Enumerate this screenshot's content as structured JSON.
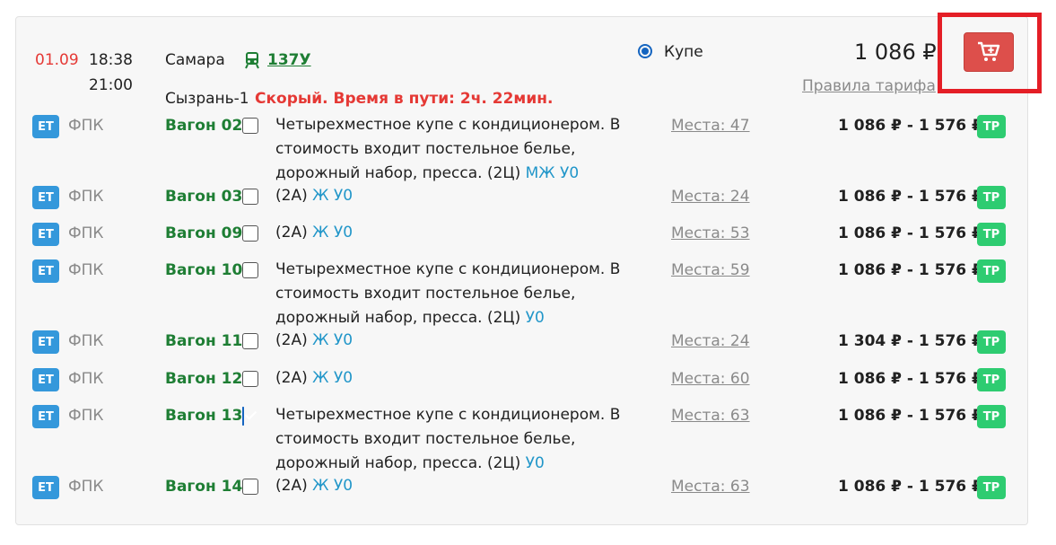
{
  "header": {
    "date": "01.09",
    "depart_time": "18:38",
    "arrive_time": "21:00",
    "from_station": "Самара",
    "train_number": "137У",
    "to_station": "Сызрань-1",
    "route_info": "Скорый. Время в пути: 2ч. 22мин.",
    "class_label": "Купе",
    "price": "1 086 ₽",
    "tariff_link": "Правила тарифа",
    "icons": {
      "train": "train-icon",
      "cart": "cart-plus-icon"
    }
  },
  "colors": {
    "accent_red": "#dd4f4b",
    "highlight": "#e41e26",
    "green_link": "#1e7e34",
    "tag_blue": "#2196c9",
    "badge_blue": "#3498db",
    "badge_green": "#2ecc71"
  },
  "wagons": [
    {
      "badge": "ЕТ",
      "carrier": "ФПК",
      "name": "Вагон 02",
      "checked": false,
      "desc_lines": [
        "Четырехместное купе с кондиционером. В",
        "стоимость входит постельное белье,",
        "дорожный набор, пресса. (2Ц)"
      ],
      "tags": "МЖ У0",
      "seats": "Места: 47",
      "range": "1 086 ₽ - 1 576 ₽",
      "badge2": "ТР"
    },
    {
      "badge": "ЕТ",
      "carrier": "ФПК",
      "name": "Вагон 03",
      "checked": false,
      "desc_lines": [
        "(2А)"
      ],
      "tags": "Ж У0",
      "seats": "Места: 24",
      "range": "1 086 ₽ - 1 576 ₽",
      "badge2": "ТР"
    },
    {
      "badge": "ЕТ",
      "carrier": "ФПК",
      "name": "Вагон 09",
      "checked": false,
      "desc_lines": [
        "(2А)"
      ],
      "tags": "Ж У0",
      "seats": "Места: 53",
      "range": "1 086 ₽ - 1 576 ₽",
      "badge2": "ТР"
    },
    {
      "badge": "ЕТ",
      "carrier": "ФПК",
      "name": "Вагон 10",
      "checked": false,
      "desc_lines": [
        "Четырехместное купе с кондиционером. В",
        "стоимость входит постельное белье,",
        "дорожный набор, пресса. (2Ц)"
      ],
      "tags": "У0",
      "seats": "Места: 59",
      "range": "1 086 ₽ - 1 576 ₽",
      "badge2": "ТР"
    },
    {
      "badge": "ЕТ",
      "carrier": "ФПК",
      "name": "Вагон 11",
      "checked": false,
      "desc_lines": [
        "(2А)"
      ],
      "tags": "Ж У0",
      "seats": "Места: 24",
      "range": "1 304 ₽ - 1 576 ₽",
      "badge2": "ТР"
    },
    {
      "badge": "ЕТ",
      "carrier": "ФПК",
      "name": "Вагон 12",
      "checked": false,
      "desc_lines": [
        "(2А)"
      ],
      "tags": "Ж У0",
      "seats": "Места: 60",
      "range": "1 086 ₽ - 1 576 ₽",
      "badge2": "ТР"
    },
    {
      "badge": "ЕТ",
      "carrier": "ФПК",
      "name": "Вагон 13",
      "checked": true,
      "desc_lines": [
        "Четырехместное купе с кондиционером. В",
        "стоимость входит постельное белье,",
        "дорожный набор, пресса. (2Ц)"
      ],
      "tags": "У0",
      "seats": "Места: 63",
      "range": "1 086 ₽ - 1 576 ₽",
      "badge2": "ТР"
    },
    {
      "badge": "ЕТ",
      "carrier": "ФПК",
      "name": "Вагон 14",
      "checked": false,
      "desc_lines": [
        "(2А)"
      ],
      "tags": "Ж У0",
      "seats": "Места: 63",
      "range": "1 086 ₽ - 1 576 ₽",
      "badge2": "ТР"
    }
  ]
}
